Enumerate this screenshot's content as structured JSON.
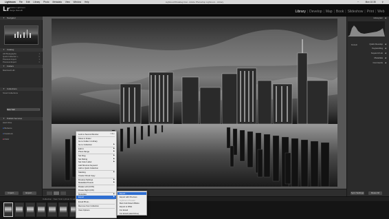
{
  "menubar": {
    "app": "Lightroom",
    "items": [
      "File",
      "Edit",
      "Library",
      "Photo",
      "Metadata",
      "View",
      "Window",
      "Help"
    ],
    "title": "Lightroom5Catalog.lrcat - Adobe Photoshop Lightroom - Library",
    "clock": "Mon 10:35"
  },
  "identity": {
    "logo": "Lr",
    "line1": "Adobe Lightroom",
    "line2": "Serge Ramelli"
  },
  "modules": [
    "Library",
    "Develop",
    "Map",
    "Book",
    "Slideshow",
    "Print",
    "Web"
  ],
  "left_panel": {
    "navigator": "Navigator",
    "catalog": "Catalog",
    "catalog_rows": [
      {
        "label": "All Photographs",
        "count": "1"
      },
      {
        "label": "Quick Collection +",
        "count": "0"
      },
      {
        "label": "Previous Import",
        "count": "1"
      },
      {
        "label": "Previous Export",
        "count": "0"
      }
    ],
    "folders": "Folders",
    "folder_rows": [
      {
        "label": "Macintosh HD",
        "count": ""
      }
    ],
    "collections": "Collections",
    "collection_rows": [
      {
        "label": "Smart Collections",
        "count": ""
      },
      {
        "label": "New York",
        "count": "1"
      }
    ],
    "publish": "Publish Services",
    "publish_rows": [
      {
        "label": "Hard Drive",
        "count": ""
      },
      {
        "label": "Behance",
        "count": ""
      },
      {
        "label": "Facebook",
        "count": ""
      },
      {
        "label": "Flickr",
        "count": ""
      }
    ]
  },
  "right_panel": {
    "histogram": "Histogram",
    "quick_develop": "Quick Develop",
    "keywording": "Keywording",
    "keyword_list": "Keyword List",
    "metadata": "Metadata",
    "comments": "Comments",
    "preset_label": "Default"
  },
  "toolbar": {
    "import": "Import...",
    "export": "Export...",
    "sync": "Sync Settings",
    "reset": "Reset All"
  },
  "filmstrip_bar": "Collection : New York   1 photo /1 selected /Brooklyn Bridge Park.dng",
  "context_menu": {
    "items": [
      {
        "label": "Lock to Second Monitor",
        "shortcut": "⇧⌘↵",
        "submenu": false
      },
      {
        "sep": true
      },
      {
        "label": "Show in Finder",
        "submenu": false
      },
      {
        "label": "Go to Folder in Library",
        "submenu": false
      },
      {
        "label": "Go to Collection",
        "submenu": true
      },
      {
        "sep": true
      },
      {
        "label": "Edit In",
        "submenu": true
      },
      {
        "label": "Photo Merge",
        "submenu": true
      },
      {
        "sep": true
      },
      {
        "label": "Set Flag",
        "submenu": true
      },
      {
        "label": "Set Rating",
        "submenu": true
      },
      {
        "label": "Set Color Label",
        "submenu": true
      },
      {
        "label": "Add Shortcut Keyword",
        "submenu": false
      },
      {
        "label": "Add to Quick Collection",
        "submenu": false
      },
      {
        "sep": true
      },
      {
        "label": "Stacking",
        "submenu": true
      },
      {
        "label": "Create Virtual Copy",
        "submenu": false
      },
      {
        "sep": true
      },
      {
        "label": "Develop Settings",
        "submenu": true
      },
      {
        "label": "Metadata Presets",
        "submenu": true
      },
      {
        "sep": true
      },
      {
        "label": "Rotate Left (CCW)",
        "submenu": false
      },
      {
        "label": "Rotate Right (CW)",
        "submenu": false
      },
      {
        "sep": true
      },
      {
        "label": "Metadata",
        "submenu": true
      },
      {
        "label": "Export",
        "submenu": true,
        "highlight": true
      },
      {
        "sep": true
      },
      {
        "label": "Email Photo...",
        "submenu": false
      },
      {
        "sep": true
      },
      {
        "label": "Remove from Collection",
        "submenu": false
      },
      {
        "sep": true
      },
      {
        "label": "View Options",
        "submenu": false
      }
    ]
  },
  "submenu": {
    "items": [
      {
        "label": "Export...",
        "highlight": true
      },
      {
        "label": "Export with Previous"
      },
      {
        "label": "Lightroom Presets",
        "disabled": true
      },
      {
        "label": "Burn Full-Sized JPEGs"
      },
      {
        "label": "Export to DNG"
      },
      {
        "label": "For Email"
      },
      {
        "label": "For Email (Hard Drive)"
      }
    ]
  }
}
